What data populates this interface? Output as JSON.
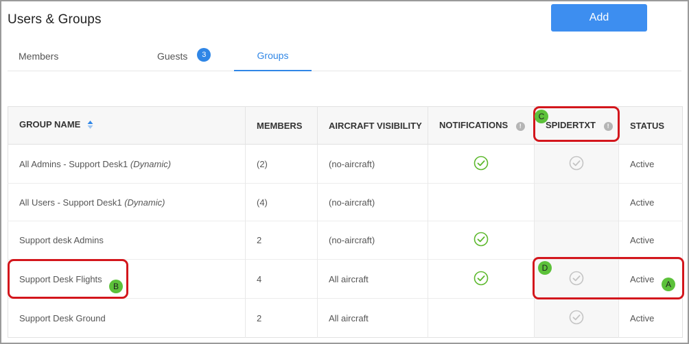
{
  "header": {
    "title": "Users & Groups",
    "add_label": "Add"
  },
  "tabs": [
    {
      "label": "Members"
    },
    {
      "label": "Guests",
      "badge": "3"
    },
    {
      "label": "Groups",
      "active": true
    }
  ],
  "table": {
    "columns": {
      "group_name": "GROUP NAME",
      "members": "MEMBERS",
      "aircraft_visibility": "AIRCRAFT VISIBILITY",
      "notifications": "NOTIFICATIONS",
      "spidertxt": "SPIDERTXT",
      "status": "STATUS"
    },
    "rows": [
      {
        "name": "All Admins - Support Desk1",
        "suffix": "(Dynamic)",
        "members": "(2)",
        "visibility": "(no-aircraft)",
        "notifications": true,
        "spidertxt": true,
        "status": "Active"
      },
      {
        "name": "All Users - Support Desk1",
        "suffix": "(Dynamic)",
        "members": "(4)",
        "visibility": "(no-aircraft)",
        "notifications": false,
        "spidertxt": false,
        "status": "Active"
      },
      {
        "name": "Support desk Admins",
        "suffix": "",
        "members": "2",
        "visibility": "(no-aircraft)",
        "notifications": true,
        "spidertxt": false,
        "status": "Active"
      },
      {
        "name": "Support Desk Flights",
        "suffix": "",
        "members": "4",
        "visibility": "All aircraft",
        "notifications": true,
        "spidertxt": true,
        "status": "Active"
      },
      {
        "name": "Support Desk Ground",
        "suffix": "",
        "members": "2",
        "visibility": "All aircraft",
        "notifications": false,
        "spidertxt": true,
        "status": "Active"
      }
    ]
  },
  "annotations": {
    "a": "A",
    "b": "B",
    "c": "C",
    "d": "D"
  },
  "colors": {
    "accent": "#2f86e6",
    "check_green": "#5cb82c",
    "check_gray": "#c4c4c4",
    "callout_red": "#d3161c",
    "marker_green": "#5cc13a"
  }
}
